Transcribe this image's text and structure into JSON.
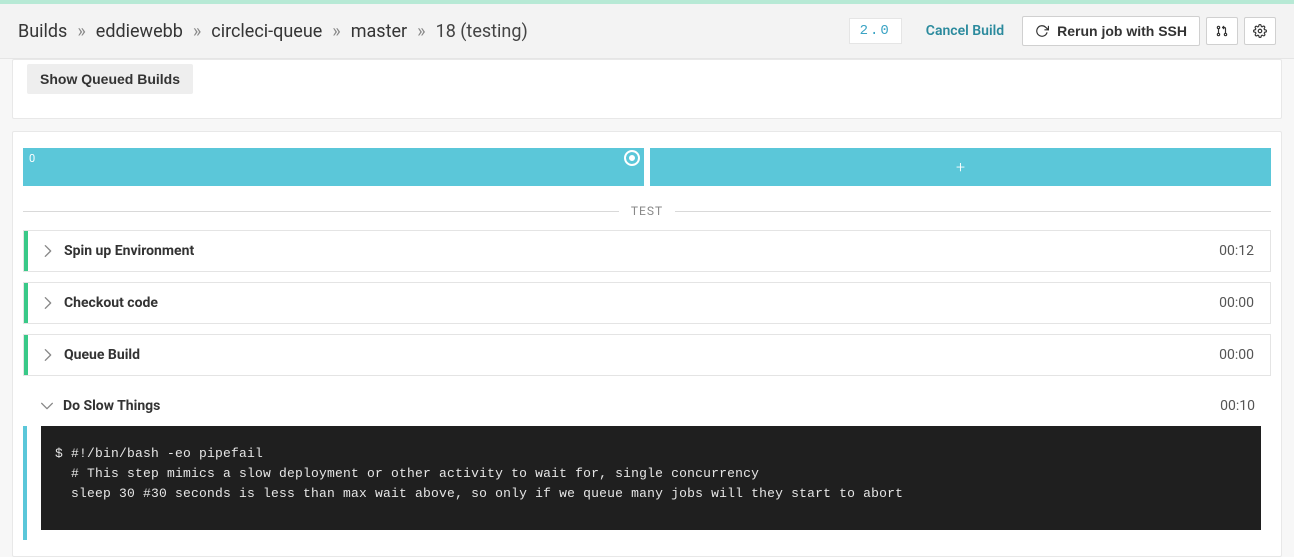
{
  "header": {
    "breadcrumb": {
      "root": "Builds",
      "org": "eddiewebb",
      "repo": "circleci-queue",
      "branch": "master",
      "build": "18 (testing)"
    },
    "version": "2.0",
    "cancel_label": "Cancel Build",
    "rerun_label": "Rerun job with SSH"
  },
  "queued": {
    "show_label": "Show Queued Builds"
  },
  "segments": {
    "first_label": "0"
  },
  "section_label": "TEST",
  "steps": [
    {
      "id": "spin-up",
      "title": "Spin up Environment",
      "time": "00:12",
      "status": "green",
      "expanded": false
    },
    {
      "id": "checkout",
      "title": "Checkout code",
      "time": "00:00",
      "status": "green",
      "expanded": false
    },
    {
      "id": "queue",
      "title": "Queue Build",
      "time": "00:00",
      "status": "green",
      "expanded": false
    },
    {
      "id": "slow",
      "title": "Do Slow Things",
      "time": "00:10",
      "status": "blue",
      "expanded": true
    }
  ],
  "console": {
    "prompt": "$ ",
    "lines": [
      "#!/bin/bash -eo pipefail",
      "# This step mimics a slow deployment or other activity to wait for, single concurrency",
      "sleep 30 #30 seconds is less than max wait above, so only if we queue many jobs will they start to abort"
    ]
  }
}
